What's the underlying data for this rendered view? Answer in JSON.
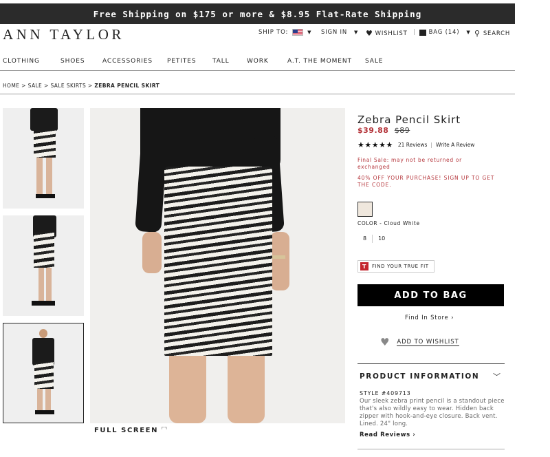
{
  "promo_bar": {
    "text": "Free Shipping on $175 or more & $8.95 Flat-Rate Shipping"
  },
  "header": {
    "logo": "ANN TAYLOR",
    "ship_to_label": "SHIP TO:",
    "sign_in": "SIGN IN",
    "wishlist": "WISHLIST",
    "bag": "BAG (14)",
    "search": "SEARCH"
  },
  "nav": {
    "items": [
      "CLOTHING",
      "SHOES",
      "ACCESSORIES",
      "PETITES",
      "TALL",
      "WORK",
      "A.T. THE MOMENT",
      "SALE"
    ]
  },
  "breadcrumb": {
    "items": [
      "HOME",
      "SALE",
      "SALE SKIRTS"
    ],
    "current": "ZEBRA PENCIL SKIRT",
    "separator": ">"
  },
  "gallery": {
    "full_screen": "FULL SCREEN",
    "active_thumb_index": 2
  },
  "product": {
    "title": "Zebra Pencil Skirt",
    "sale_price": "$39.88",
    "original_price": "$89",
    "rating_stars": 5,
    "reviews_count": "21 Reviews",
    "write_review": "Write A Review",
    "final_sale": "Final Sale: may not be returned or exchanged",
    "promo": "40% OFF YOUR PURCHASE! SIGN UP TO GET THE CODE.",
    "color_label": "COLOR - Cloud White",
    "swatch_color": "#efe7dd",
    "sizes": [
      "8",
      "10"
    ],
    "true_fit": "FIND YOUR TRUE FIT",
    "add_to_bag": "ADD TO BAG",
    "find_in_store": "Find In Store",
    "add_to_wishlist": "ADD TO WISHLIST"
  },
  "product_info": {
    "heading": "PRODUCT INFORMATION",
    "style": "STYLE #409713",
    "description": "Our sleek zebra print pencil is a standout piece that's also wildly easy to wear. Hidden back zipper with hook-and-eye closure. Back vent. Lined. 24\" long.",
    "read_reviews": "Read Reviews"
  },
  "colors": {
    "sale_red": "#b4343a",
    "promo_bar_bg": "#2b2b2b",
    "button_black": "#000000"
  }
}
